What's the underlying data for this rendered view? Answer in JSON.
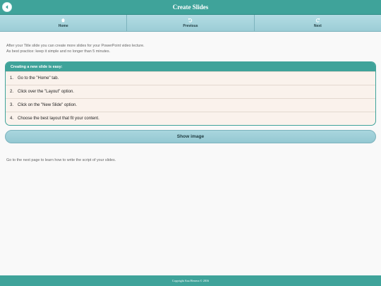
{
  "header": {
    "title": "Create Slides",
    "back_icon": "back-arrow-icon"
  },
  "nav": {
    "items": [
      {
        "label": "Home",
        "icon": "home-icon"
      },
      {
        "label": "Previous",
        "icon": "undo-icon"
      },
      {
        "label": "Next",
        "icon": "redo-icon"
      }
    ]
  },
  "intro": {
    "line1": "After your Title slide you can create more slides for your PowerPoint video lecture.",
    "line2": "As best practice: keep it simple and no longer than 5 minutes."
  },
  "panel": {
    "title": "Creating a new slide is easy:",
    "steps": [
      {
        "num": "1.",
        "text": "Go to the \"Home\" tab."
      },
      {
        "num": "2.",
        "text": "Click over the \"Layout\" option."
      },
      {
        "num": "3.",
        "text": "Click on the \"New Slide\" option."
      },
      {
        "num": "4.",
        "text": "Choose the best layout that fit your content."
      }
    ]
  },
  "show_image_label": "Show image",
  "outro": "Go to the next page to learn how to write the script of your slides.",
  "footer": "Copyright Ana Herrera © 2016",
  "colors": {
    "teal": "#3fa39a",
    "nav": "#a6d4dc",
    "panel_bg": "#faf2ec"
  }
}
